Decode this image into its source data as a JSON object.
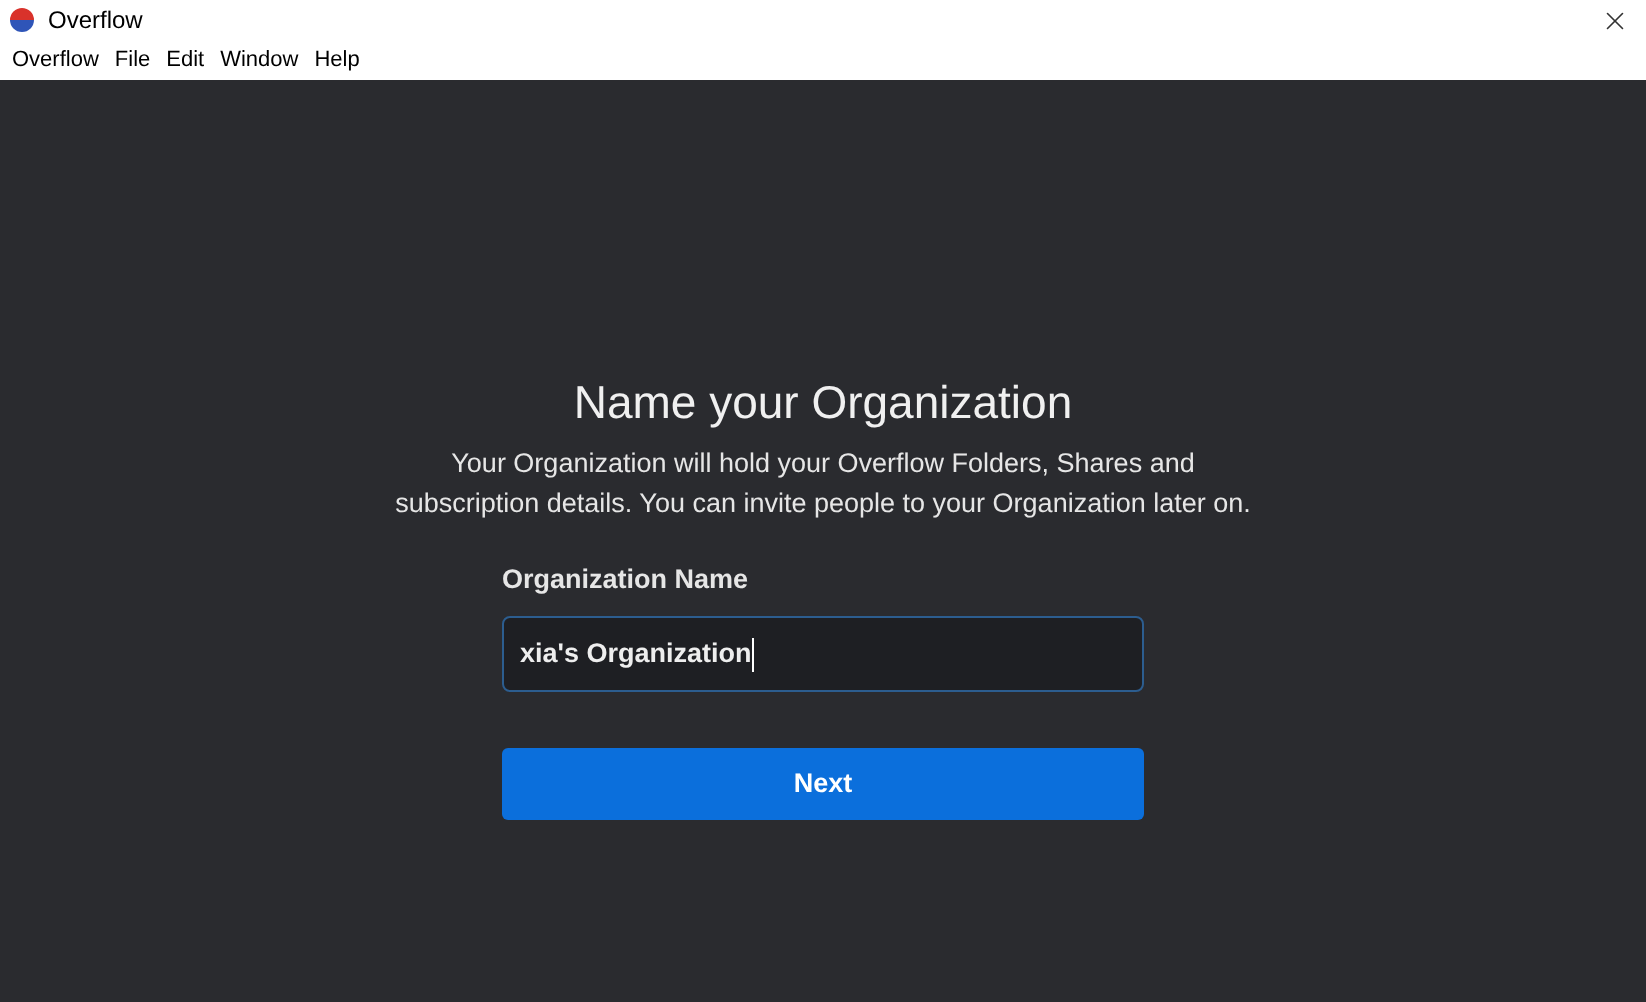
{
  "window": {
    "title": "Overflow"
  },
  "menu": [
    "Overflow",
    "File",
    "Edit",
    "Window",
    "Help"
  ],
  "heading": "Name your Organization",
  "description": "Your Organization will hold your Overflow Folders, Shares and subscription details. You can invite people to your Organization later on.",
  "field": {
    "label": "Organization Name",
    "value": "xia's Organization",
    "focused": true
  },
  "button": "Next"
}
